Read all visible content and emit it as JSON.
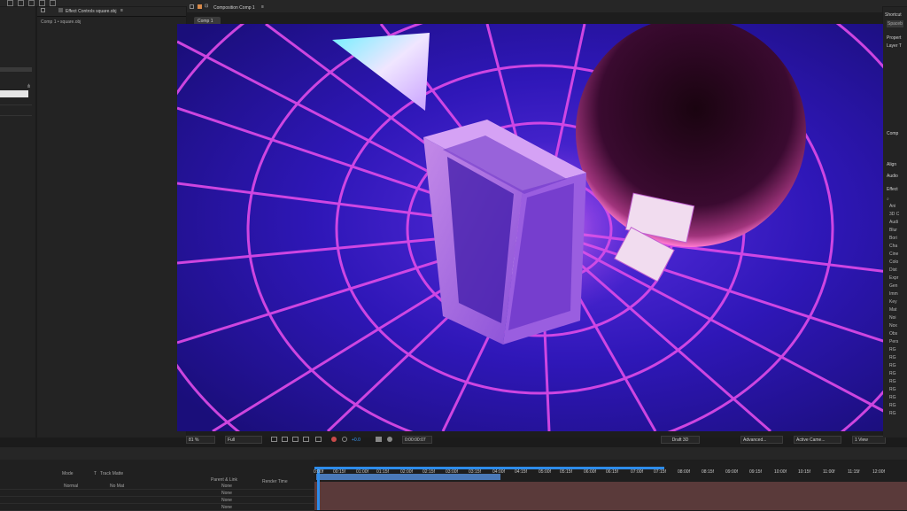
{
  "effect_controls": {
    "tab": "Effect Controls square.obj",
    "path": "Comp 1 • square.obj"
  },
  "composition": {
    "tab": "Composition Comp 1",
    "subtab": "Comp 1"
  },
  "viewer_controls": {
    "zoom": "81 %",
    "resolution": "Full",
    "exposure": "+0.0",
    "timecode": "0:00:00:07",
    "renderer": "Draft 3D",
    "renderer_mode": "Advanced...",
    "camera": "Active Came...",
    "views": "1 View"
  },
  "right_panel": {
    "shortcut": "Shortcut",
    "space": "Spaceb",
    "properties": "Propert",
    "layer": "Layer T",
    "comp": "Comp",
    "align": "Align",
    "audio": "Audio",
    "effects": "Effect",
    "effect_items": [
      "Ani",
      "3D C",
      "Audi",
      "Blur",
      "Bori",
      "Cha",
      "Cine",
      "Colo",
      "Dist",
      "Expr",
      "Gen",
      "Imm",
      "Key",
      "Mat",
      "Noi",
      "Nox",
      "Obs",
      "Pers",
      "RG",
      "RG",
      "RG",
      "RG",
      "RG",
      "RG",
      "RG",
      "RG",
      "RG"
    ]
  },
  "timeline": {
    "headers": {
      "mode": "Mode",
      "t": "T",
      "track_matte": "Track Matte",
      "parent": "Parent & Link",
      "render_time": "Render Time"
    },
    "mode_value": "Normal",
    "matte_value": "No Mat",
    "parent_values": [
      "None",
      "None",
      "None",
      "None"
    ],
    "ruler": [
      "0:00f",
      "00:15f",
      "01:00f",
      "01:15f",
      "02:00f",
      "02:15f",
      "03:00f",
      "03:15f",
      "04:00f",
      "04:15f",
      "05:00f",
      "05:15f",
      "06:00f",
      "06:15f",
      "07:00f",
      "07:15f",
      "08:00f",
      "08:15f",
      "09:00f",
      "09:15f",
      "10:00f",
      "10:15f",
      "11:00f",
      "11:15f",
      "12:00f"
    ]
  },
  "colors": {
    "accent": "#2d8ceb",
    "comp_bg": "#2a14a8",
    "grid": "#e04be8"
  }
}
